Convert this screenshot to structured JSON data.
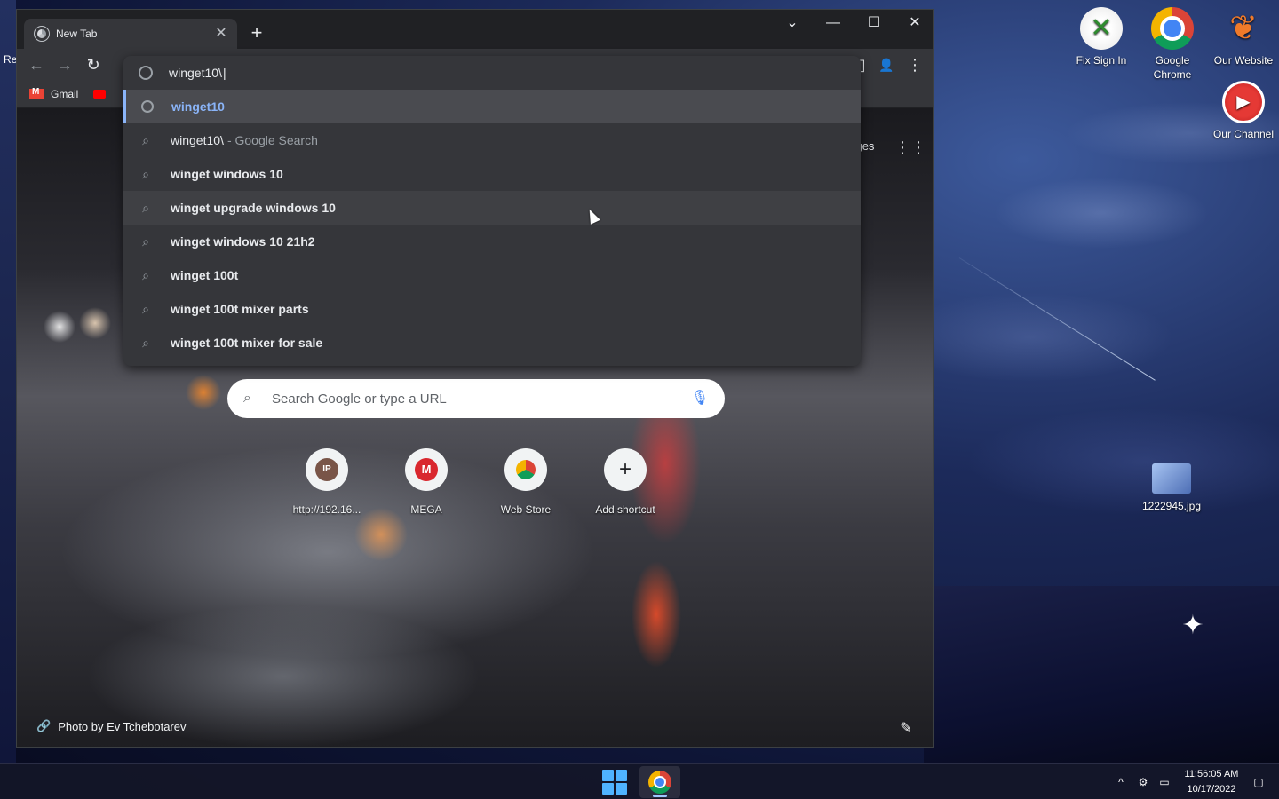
{
  "desktop": {
    "left_label": "Re",
    "icons": [
      {
        "label": "Fix Sign In",
        "icon": "xbox-icon"
      },
      {
        "label": "Google Chrome",
        "icon": "chrome-icon"
      },
      {
        "label": "Our Website",
        "icon": "website-icon"
      },
      {
        "label": "Our Channel",
        "icon": "youtube-icon"
      },
      {
        "label": "1222945.jpg",
        "icon": "image-file-icon"
      }
    ]
  },
  "browser": {
    "tab": {
      "title": "New Tab",
      "close": "✕"
    },
    "new_tab": "+",
    "window_controls": {
      "tab_search": "⌄",
      "minimize": "—",
      "maximize": "☐",
      "close": "✕"
    },
    "toolbar": {
      "back": "←",
      "forward": "→",
      "reload": "↻",
      "side_panel": "◧",
      "profile": "👤",
      "menu": "⋮"
    },
    "bookmarks": [
      {
        "label": "Gmail",
        "icon": "gmail-icon"
      },
      {
        "label": "",
        "icon": "youtube-icon"
      }
    ],
    "omnibox": {
      "input_value": "winget10\\",
      "suggestions": [
        {
          "text": "winget10",
          "hint": "",
          "type": "url",
          "state": "selected"
        },
        {
          "text": "winget10\\",
          "hint": "- Google Search",
          "type": "search",
          "state": "normal"
        },
        {
          "text": "winget windows 10",
          "hint": "",
          "type": "search",
          "state": "normal"
        },
        {
          "text": "winget upgrade windows 10",
          "hint": "",
          "type": "search",
          "state": "hover"
        },
        {
          "text": "winget windows 10 21h2",
          "hint": "",
          "type": "search",
          "state": "normal"
        },
        {
          "text": "winget 100t",
          "hint": "",
          "type": "search",
          "state": "normal"
        },
        {
          "text": "winget 100t mixer parts",
          "hint": "",
          "type": "search",
          "state": "normal"
        },
        {
          "text": "winget 100t mixer for sale",
          "hint": "",
          "type": "search",
          "state": "normal"
        }
      ]
    },
    "ntp": {
      "images_link": "nages",
      "apps_icon": "⋮⋮⋮",
      "search_placeholder": "Search Google or type a URL",
      "shortcuts": [
        {
          "label": "http://192.16...",
          "tile": "IP",
          "color": "#795548"
        },
        {
          "label": "MEGA",
          "tile": "M",
          "color": "#d9272e"
        },
        {
          "label": "Web Store",
          "tile": "◔",
          "color": "#4285f4"
        },
        {
          "label": "Add shortcut",
          "tile": "+",
          "color": "#202124"
        }
      ],
      "photo_credit": "Photo by Ev Tchebotarev"
    }
  },
  "taskbar": {
    "time": "11:56:05 AM",
    "date": "10/17/2022"
  },
  "colors": {
    "chrome_dark_bg": "#202124",
    "toolbar_bg": "#35363a",
    "accent_blue": "#8ab4f8"
  }
}
